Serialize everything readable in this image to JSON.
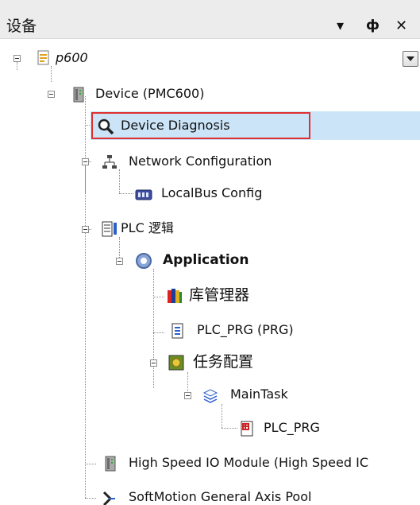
{
  "window": {
    "title": "设备",
    "controls": {
      "dropdown": "▾",
      "pin": "ф",
      "close": "✕"
    }
  },
  "tree": {
    "root": {
      "label": "p600",
      "icon": "project-document-icon"
    },
    "device": {
      "label": "Device (PMC600)",
      "icon": "device-module-icon"
    },
    "diagnosis": {
      "label": "Device Diagnosis",
      "icon": "magnifier-icon"
    },
    "network": {
      "label": "Network Configuration",
      "icon": "network-topology-icon"
    },
    "localbus": {
      "label": "LocalBus Config",
      "icon": "bus-module-icon"
    },
    "plc_logic": {
      "label": "PLC 逻辑",
      "icon": "plc-logic-icon"
    },
    "application": {
      "label": "Application",
      "icon": "application-gear-icon"
    },
    "library": {
      "label": "库管理器",
      "icon": "library-books-icon"
    },
    "plc_prg": {
      "label": "PLC_PRG (PRG)",
      "icon": "program-document-icon"
    },
    "task_config": {
      "label": "任务配置",
      "icon": "task-config-icon"
    },
    "main_task": {
      "label": "MainTask",
      "icon": "task-stack-icon"
    },
    "plc_prg_call": {
      "label": "PLC_PRG",
      "icon": "program-call-icon"
    },
    "hsio": {
      "label": "High Speed IO Module (High Speed IC",
      "icon": "device-module-icon"
    },
    "softmotion": {
      "label": "SoftMotion General Axis Pool",
      "icon": "axis-pool-icon"
    }
  },
  "colors": {
    "selection": "#cce4f7",
    "highlight_border": "#e03030",
    "titlebar": "#ececec"
  }
}
